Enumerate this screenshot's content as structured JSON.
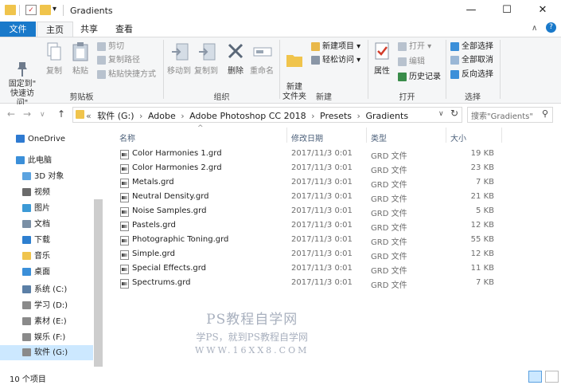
{
  "window": {
    "title": "Gradients",
    "minimize": "—",
    "maximize": "☐",
    "close": "✕"
  },
  "quick_access": {
    "dropdown": "▾"
  },
  "tabs": [
    {
      "label": "文件"
    },
    {
      "label": "主页"
    },
    {
      "label": "共享"
    },
    {
      "label": "查看"
    }
  ],
  "ribbon_extra": {
    "collapse": "∧",
    "help": "?"
  },
  "ribbon": {
    "clipboard": {
      "group": "剪贴板",
      "pin": "固定到\"\n快速访问\"",
      "copy": "复制",
      "paste": "粘贴",
      "cut": "剪切",
      "copy_path": "复制路径",
      "paste_shortcut": "粘贴快捷方式"
    },
    "organize": {
      "group": "组织",
      "move_to": "移动到",
      "copy_to": "复制到",
      "delete": "删除",
      "rename": "重命名"
    },
    "new": {
      "group": "新建",
      "new_folder": "新建\n文件夹",
      "new_item": "新建项目 ▾",
      "easy_access": "轻松访问 ▾"
    },
    "open": {
      "group": "打开",
      "properties": "属性",
      "open": "打开 ▾",
      "edit": "编辑",
      "history": "历史记录"
    },
    "select": {
      "group": "选择",
      "select_all": "全部选择",
      "select_none": "全部取消",
      "invert": "反向选择"
    }
  },
  "nav": {
    "back": "←",
    "forward": "→",
    "dropdown": "∨",
    "up": "↑",
    "path_prefix": "«",
    "path": [
      "软件 (G:)",
      "Adobe",
      "Adobe Photoshop CC 2018",
      "Presets",
      "Gradients"
    ],
    "sep": "›",
    "addr_dropdown": "∨",
    "refresh": "↻",
    "search_placeholder": "搜索\"Gradients\"",
    "search_icon": "⚲"
  },
  "sidebar": [
    {
      "label": "OneDrive",
      "icon": "cloud-icon",
      "color": "#2e7ad1"
    },
    {
      "label": "此电脑",
      "icon": "computer-icon",
      "color": "#3b8fd9"
    },
    {
      "label": "3D 对象",
      "icon": "cube-icon",
      "color": "#5ba3e0"
    },
    {
      "label": "视频",
      "icon": "video-icon",
      "color": "#6b6b6b"
    },
    {
      "label": "图片",
      "icon": "picture-icon",
      "color": "#3c9ad6"
    },
    {
      "label": "文档",
      "icon": "document-icon",
      "color": "#7a8fa5"
    },
    {
      "label": "下载",
      "icon": "download-icon",
      "color": "#2d7fd0"
    },
    {
      "label": "音乐",
      "icon": "music-icon",
      "color": "#f0c44c"
    },
    {
      "label": "桌面",
      "icon": "desktop-icon",
      "color": "#3b8fd9"
    },
    {
      "label": "系统 (C:)",
      "icon": "drive-icon",
      "color": "#5b7fa6"
    },
    {
      "label": "学习 (D:)",
      "icon": "drive-icon",
      "color": "#8a8a8a"
    },
    {
      "label": "素材 (E:)",
      "icon": "drive-icon",
      "color": "#8a8a8a"
    },
    {
      "label": "娱乐 (F:)",
      "icon": "drive-icon",
      "color": "#8a8a8a"
    },
    {
      "label": "软件 (G:)",
      "icon": "drive-icon",
      "color": "#8a8a8a"
    }
  ],
  "columns": {
    "name": "名称",
    "modified": "修改日期",
    "type": "类型",
    "size": "大小",
    "sort_indicator": "^"
  },
  "files": [
    {
      "name": "Color Harmonies 1.grd",
      "modified": "2017/11/3 0:01",
      "type": "GRD 文件",
      "size": "19 KB"
    },
    {
      "name": "Color Harmonies 2.grd",
      "modified": "2017/11/3 0:01",
      "type": "GRD 文件",
      "size": "23 KB"
    },
    {
      "name": "Metals.grd",
      "modified": "2017/11/3 0:01",
      "type": "GRD 文件",
      "size": "7 KB"
    },
    {
      "name": "Neutral Density.grd",
      "modified": "2017/11/3 0:01",
      "type": "GRD 文件",
      "size": "21 KB"
    },
    {
      "name": "Noise Samples.grd",
      "modified": "2017/11/3 0:01",
      "type": "GRD 文件",
      "size": "5 KB"
    },
    {
      "name": "Pastels.grd",
      "modified": "2017/11/3 0:01",
      "type": "GRD 文件",
      "size": "12 KB"
    },
    {
      "name": "Photographic Toning.grd",
      "modified": "2017/11/3 0:01",
      "type": "GRD 文件",
      "size": "55 KB"
    },
    {
      "name": "Simple.grd",
      "modified": "2017/11/3 0:01",
      "type": "GRD 文件",
      "size": "12 KB"
    },
    {
      "name": "Special Effects.grd",
      "modified": "2017/11/3 0:01",
      "type": "GRD 文件",
      "size": "11 KB"
    },
    {
      "name": "Spectrums.grd",
      "modified": "2017/11/3 0:01",
      "type": "GRD 文件",
      "size": "7 KB"
    }
  ],
  "watermark": {
    "line1": "PS教程自学网",
    "line2": "学PS，就到PS教程自学网",
    "line3": "WWW.16XX8.COM"
  },
  "status": {
    "count": "10 个项目"
  },
  "colors": {
    "accent": "#1979ca",
    "selection": "#cce8ff"
  }
}
